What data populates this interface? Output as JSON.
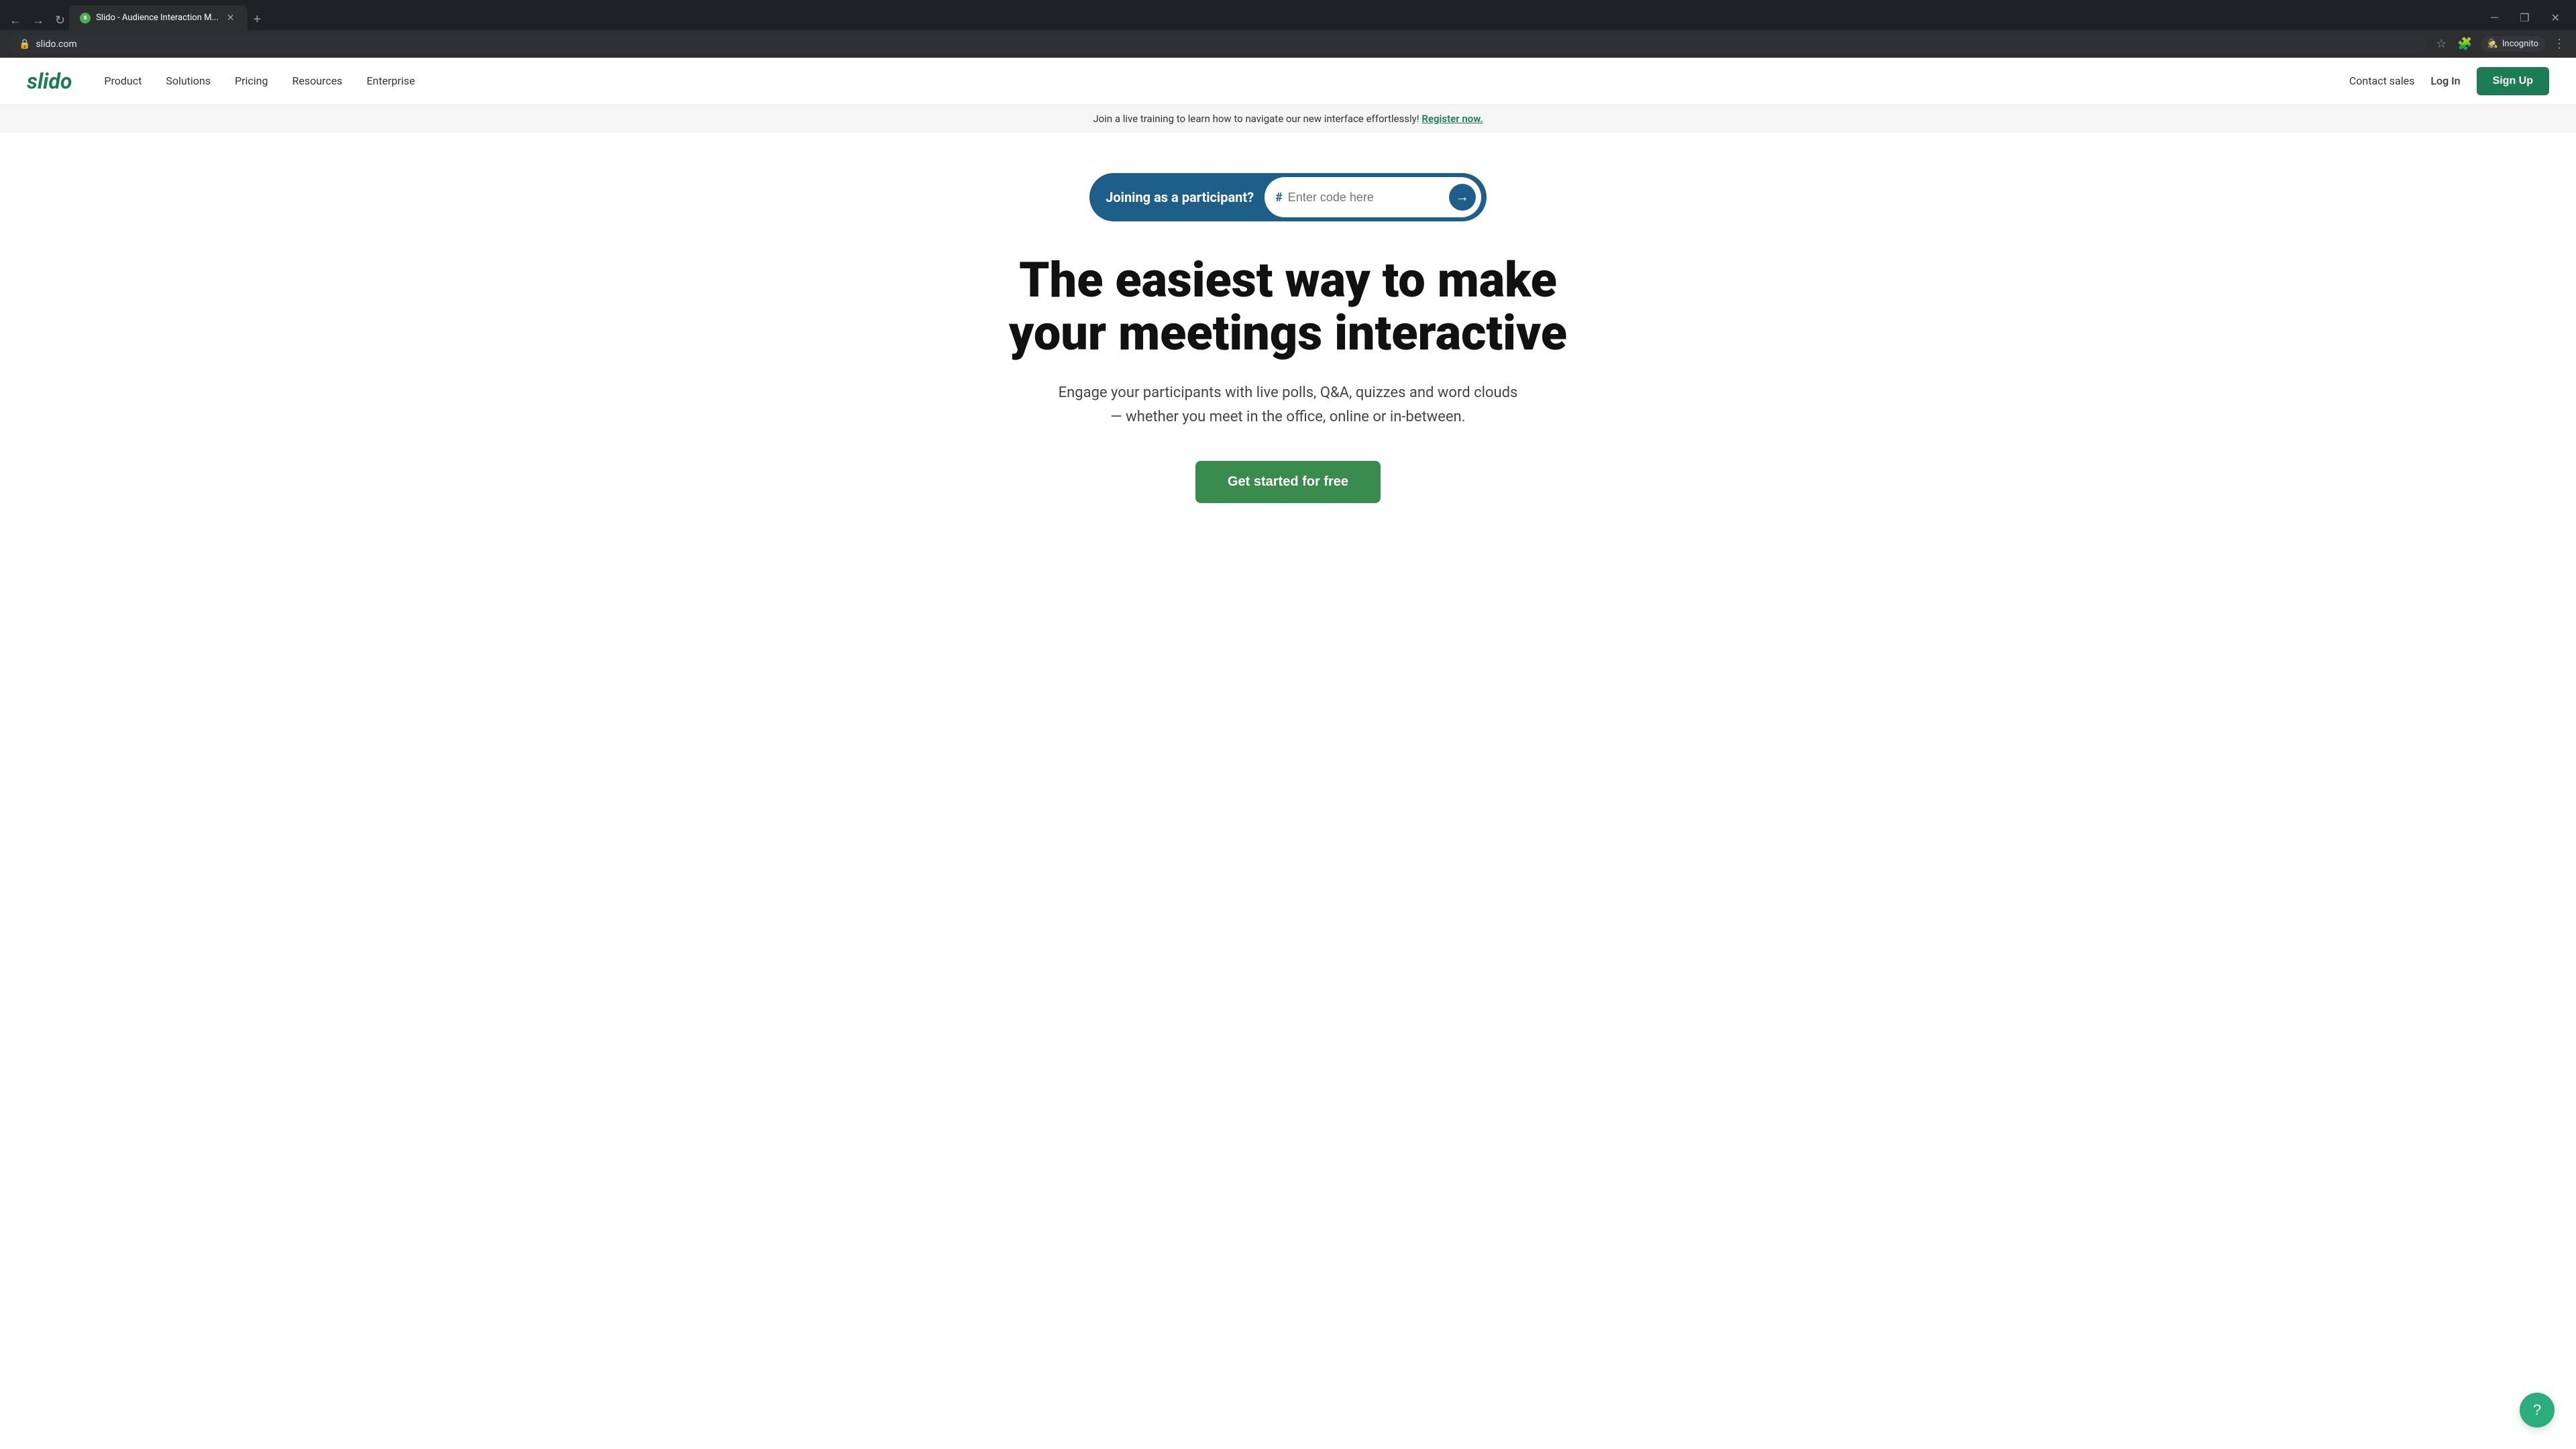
{
  "browser": {
    "tab_title": "Slido - Audience Interaction M...",
    "url": "slido.com",
    "incognito_label": "Incognito",
    "new_tab_label": "+",
    "window_controls": {
      "minimize": "─",
      "maximize": "❐",
      "close": "✕"
    }
  },
  "navbar": {
    "logo": "slido",
    "links": [
      {
        "label": "Product"
      },
      {
        "label": "Solutions"
      },
      {
        "label": "Pricing"
      },
      {
        "label": "Resources"
      },
      {
        "label": "Enterprise"
      }
    ],
    "contact_sales": "Contact sales",
    "login": "Log In",
    "signup": "Sign Up"
  },
  "banner": {
    "text": "Join a live training to learn how to navigate our new interface effortlessly!",
    "link_text": "Register now."
  },
  "hero": {
    "participant_label": "Joining as a participant?",
    "code_placeholder": "Enter code here",
    "title_line1": "The easiest way to make",
    "title_line2": "your meetings interactive",
    "subtitle": "Engage your participants with live polls, Q&A, quizzes and word clouds\n— whether you meet in the office, online or in-between.",
    "cta_label": "Get started for free"
  },
  "help": {
    "icon": "?"
  }
}
